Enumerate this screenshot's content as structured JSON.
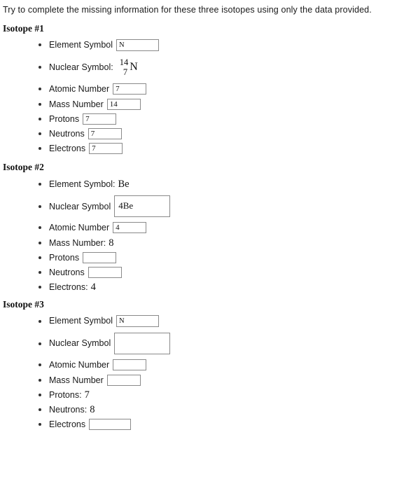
{
  "intro": "Try to complete the missing information for these three isotopes using only the data provided.",
  "isotopes": [
    {
      "heading": "Isotope #1",
      "element_symbol": {
        "label": "Element Symbol",
        "type": "input",
        "value": "N"
      },
      "nuclear_symbol": {
        "label": "Nuclear Symbol:",
        "type": "static-notation",
        "mass_number": "14",
        "atomic_number": "7",
        "element": "N"
      },
      "atomic_number": {
        "label": "Atomic Number",
        "type": "input",
        "value": "7"
      },
      "mass_number": {
        "label": "Mass Number",
        "type": "input",
        "value": "14"
      },
      "protons": {
        "label": "Protons",
        "type": "input",
        "value": "7"
      },
      "neutrons": {
        "label": "Neutrons",
        "type": "input",
        "value": "7"
      },
      "electrons": {
        "label": "Electrons",
        "type": "input",
        "value": "7"
      }
    },
    {
      "heading": "Isotope #2",
      "element_symbol": {
        "label": "Element Symbol:",
        "type": "static",
        "value": "Be"
      },
      "nuclear_symbol": {
        "label": "Nuclear Symbol",
        "type": "input",
        "value": "4Be"
      },
      "atomic_number": {
        "label": "Atomic Number",
        "type": "input",
        "value": "4"
      },
      "mass_number": {
        "label": "Mass Number:",
        "type": "static",
        "value": "8"
      },
      "protons": {
        "label": "Protons",
        "type": "input",
        "value": ""
      },
      "neutrons": {
        "label": "Neutrons",
        "type": "input",
        "value": ""
      },
      "electrons": {
        "label": "Electrons:",
        "type": "static",
        "value": "4"
      }
    },
    {
      "heading": "Isotope #3",
      "element_symbol": {
        "label": "Element Symbol",
        "type": "input",
        "value": "N"
      },
      "nuclear_symbol": {
        "label": "Nuclear Symbol",
        "type": "input",
        "value": ""
      },
      "atomic_number": {
        "label": "Atomic Number",
        "type": "input",
        "value": ""
      },
      "mass_number": {
        "label": "Mass Number",
        "type": "input",
        "value": ""
      },
      "protons": {
        "label": "Protons:",
        "type": "static",
        "value": "7"
      },
      "neutrons": {
        "label": "Neutrons:",
        "type": "static",
        "value": "8"
      },
      "electrons": {
        "label": "Electrons",
        "type": "input",
        "value": ""
      }
    }
  ]
}
